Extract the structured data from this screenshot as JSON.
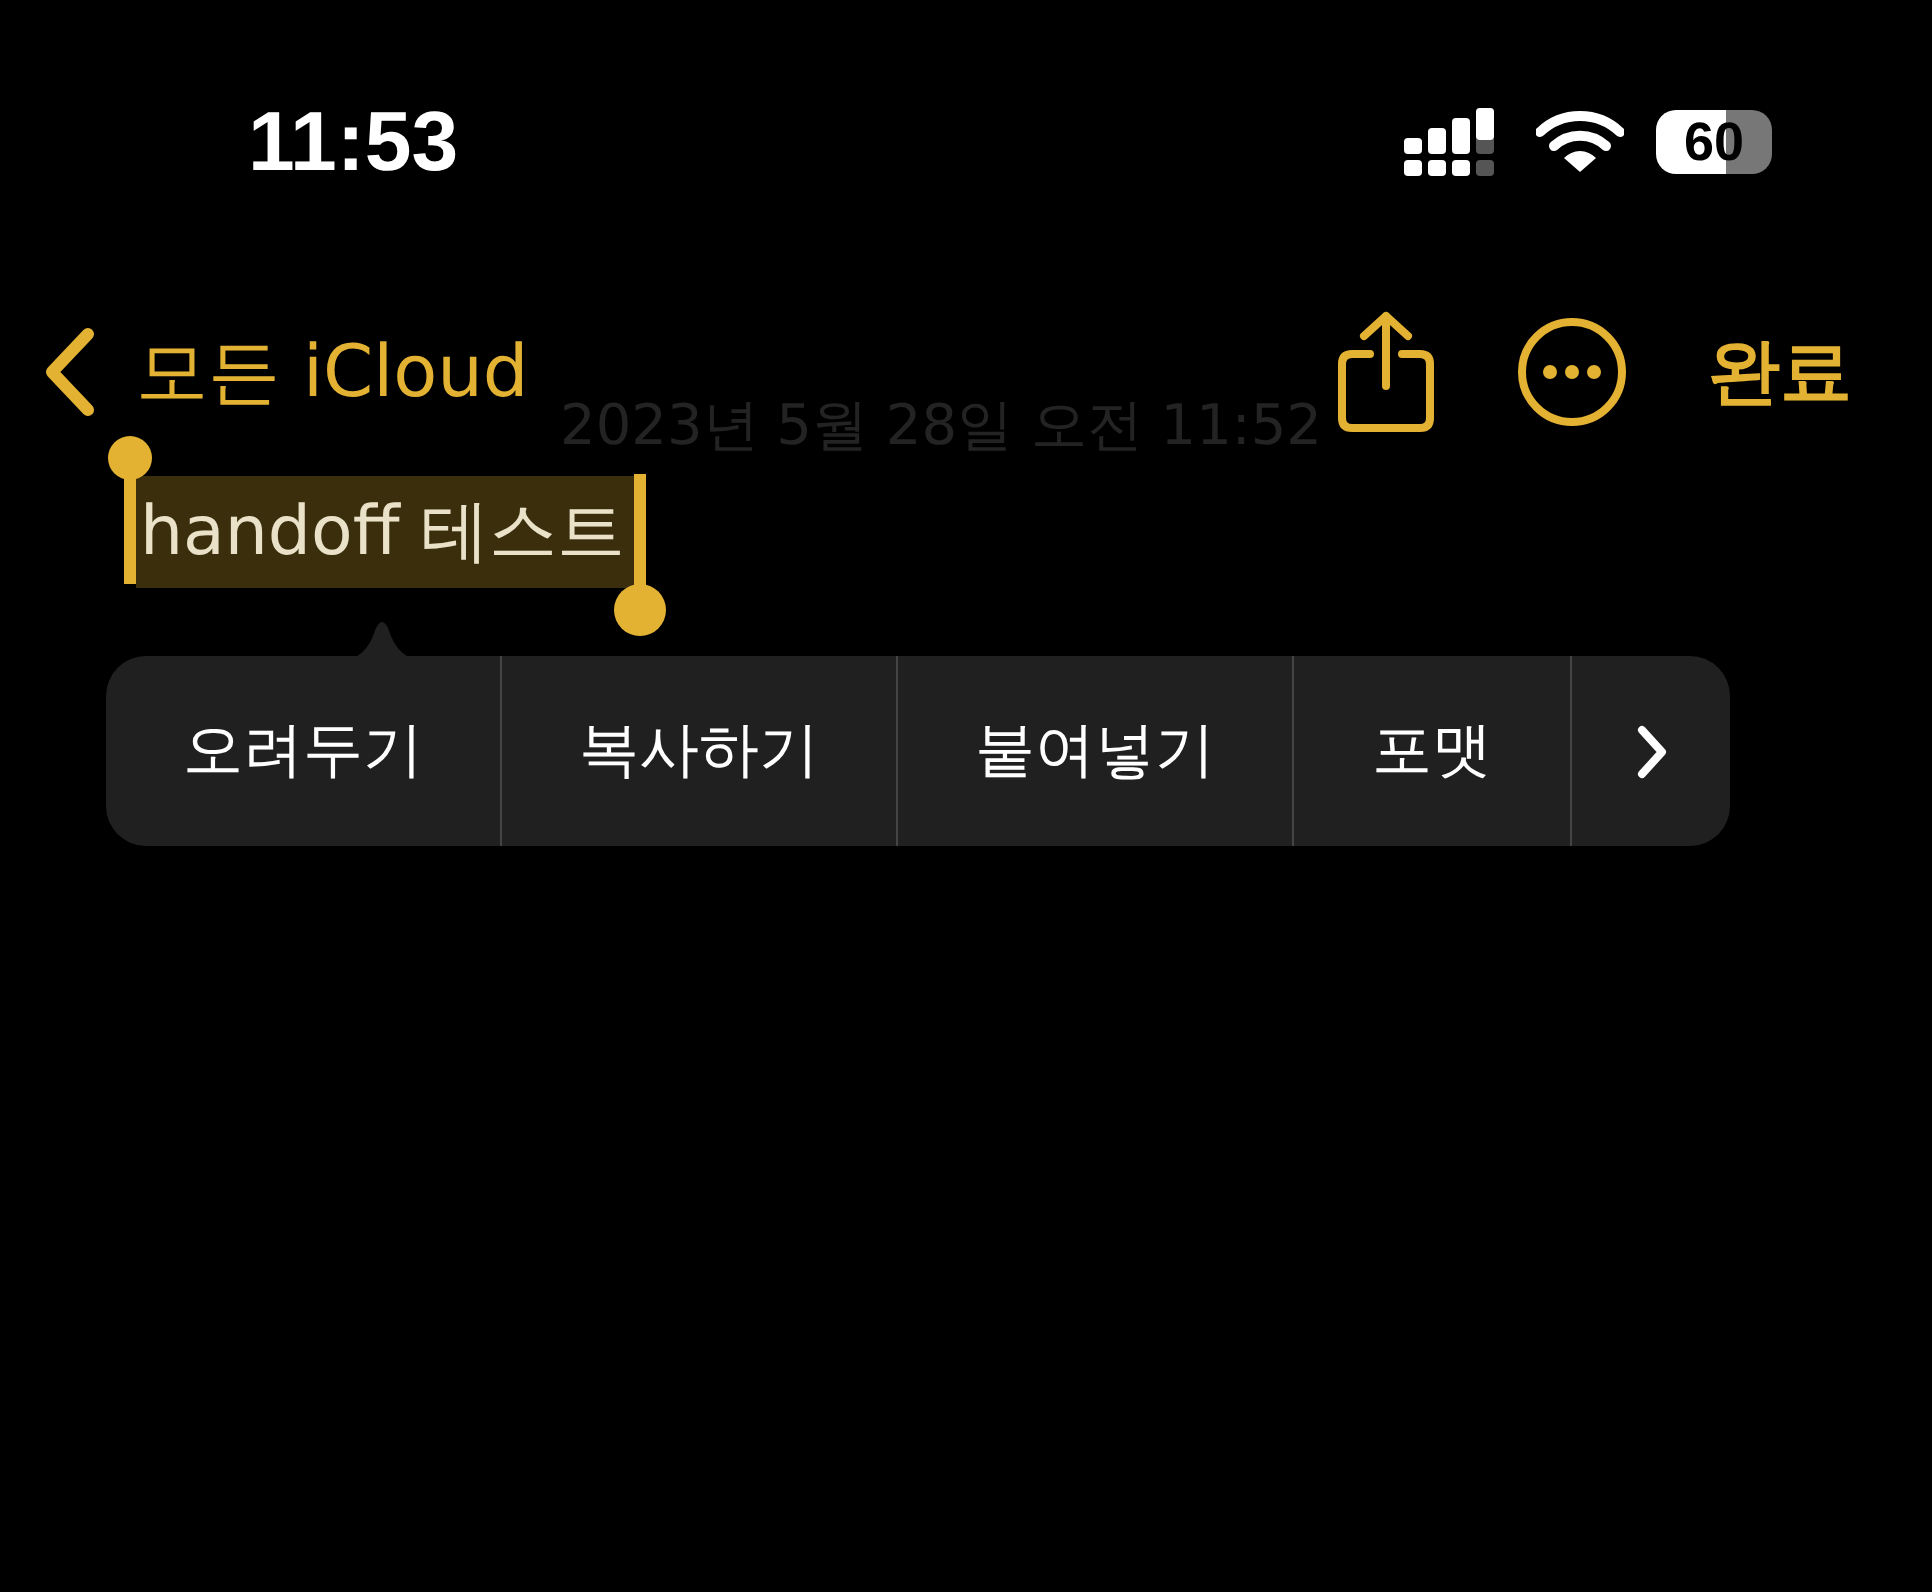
{
  "status_bar": {
    "time": "11:53",
    "battery": "60"
  },
  "nav": {
    "back_label": "모든 iCloud",
    "done_label": "완료"
  },
  "note": {
    "date": "2023년 5월 28일 오전 11:52",
    "text": "handoff 테스트",
    "selected": true
  },
  "edit_menu": {
    "items": [
      "오려두기",
      "복사하기",
      "붙여넣기",
      "포맷"
    ]
  }
}
